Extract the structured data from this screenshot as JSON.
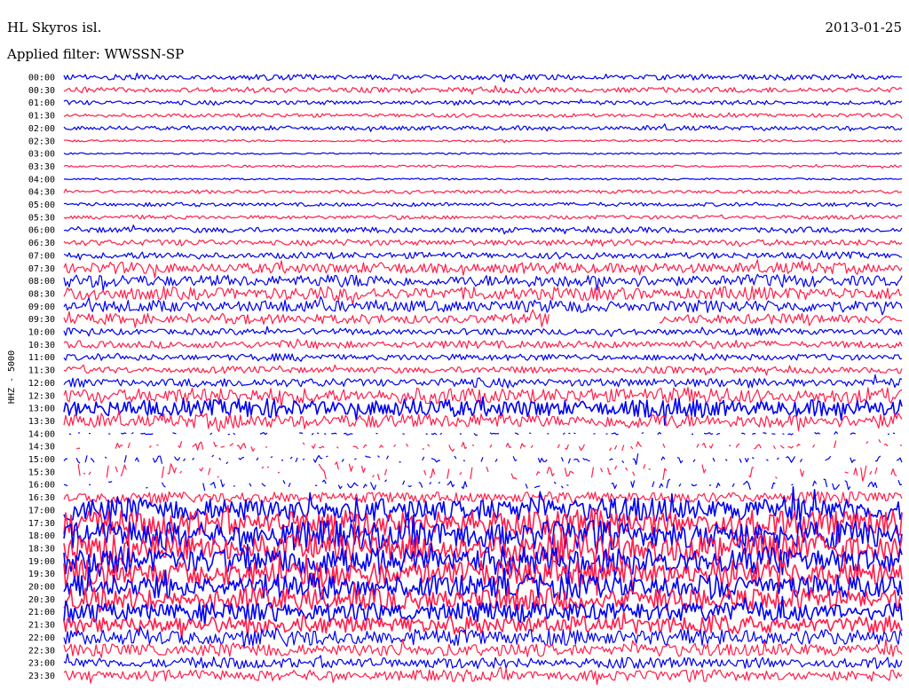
{
  "header": {
    "station": "HL Skyros isl.",
    "date": "2013-01-25",
    "filter": "Applied filter: WWSSN-SP"
  },
  "chart_data": {
    "type": "line",
    "title": "HL Skyros isl.",
    "subtitle": "Applied filter: WWSSN-SP",
    "date": "2013-01-25",
    "ylabel": "HHZ - 5000",
    "xlabel": "",
    "colors": [
      "#0000ee",
      "#ff1f4b"
    ],
    "background": "#ffffff",
    "grid": false,
    "rows": [
      {
        "label": "00:00",
        "amplitude": 0.5
      },
      {
        "label": "00:30",
        "amplitude": 0.5
      },
      {
        "label": "01:00",
        "amplitude": 0.4
      },
      {
        "label": "01:30",
        "amplitude": 0.35
      },
      {
        "label": "02:00",
        "amplitude": 0.4
      },
      {
        "label": "02:30",
        "amplitude": 0.2
      },
      {
        "label": "03:00",
        "amplitude": 0.15
      },
      {
        "label": "03:30",
        "amplitude": 0.2
      },
      {
        "label": "04:00",
        "amplitude": 0.15
      },
      {
        "label": "04:30",
        "amplitude": 0.3
      },
      {
        "label": "05:00",
        "amplitude": 0.35
      },
      {
        "label": "05:30",
        "amplitude": 0.35
      },
      {
        "label": "06:00",
        "amplitude": 0.5
      },
      {
        "label": "06:30",
        "amplitude": 0.55
      },
      {
        "label": "07:00",
        "amplitude": 0.6
      },
      {
        "label": "07:30",
        "amplitude": 1.0
      },
      {
        "label": "08:00",
        "amplitude": 1.1
      },
      {
        "label": "08:30",
        "amplitude": 1.2
      },
      {
        "label": "09:00",
        "amplitude": 1.1
      },
      {
        "label": "09:30",
        "amplitude": 0.9,
        "gap": [
          0.58,
          0.71
        ]
      },
      {
        "label": "10:00",
        "amplitude": 0.6
      },
      {
        "label": "10:30",
        "amplitude": 0.7
      },
      {
        "label": "11:00",
        "amplitude": 0.6
      },
      {
        "label": "11:30",
        "amplitude": 0.6
      },
      {
        "label": "12:00",
        "amplitude": 0.8
      },
      {
        "label": "12:30",
        "amplitude": 1.4
      },
      {
        "label": "13:00",
        "amplitude": 1.6
      },
      {
        "label": "13:30",
        "amplitude": 1.3
      },
      {
        "label": "14:00",
        "amplitude": 0.15,
        "sparse": true
      },
      {
        "label": "14:30",
        "amplitude": 0.5,
        "sparse": true
      },
      {
        "label": "15:00",
        "amplitude": 0.5,
        "sparse": true
      },
      {
        "label": "15:30",
        "amplitude": 0.9,
        "sparse": true
      },
      {
        "label": "16:00",
        "amplitude": 0.6,
        "sparse": true
      },
      {
        "label": "16:30",
        "amplitude": 1.0
      },
      {
        "label": "17:00",
        "amplitude": 2.2
      },
      {
        "label": "17:30",
        "amplitude": 2.4
      },
      {
        "label": "18:00",
        "amplitude": 2.6
      },
      {
        "label": "18:30",
        "amplitude": 2.6
      },
      {
        "label": "19:00",
        "amplitude": 2.5
      },
      {
        "label": "19:30",
        "amplitude": 2.4
      },
      {
        "label": "20:00",
        "amplitude": 2.2
      },
      {
        "label": "20:30",
        "amplitude": 2.0
      },
      {
        "label": "21:00",
        "amplitude": 1.8
      },
      {
        "label": "21:30",
        "amplitude": 1.6
      },
      {
        "label": "22:00",
        "amplitude": 1.5
      },
      {
        "label": "22:30",
        "amplitude": 1.2
      },
      {
        "label": "23:00",
        "amplitude": 1.0
      },
      {
        "label": "23:30",
        "amplitude": 1.0
      }
    ]
  }
}
